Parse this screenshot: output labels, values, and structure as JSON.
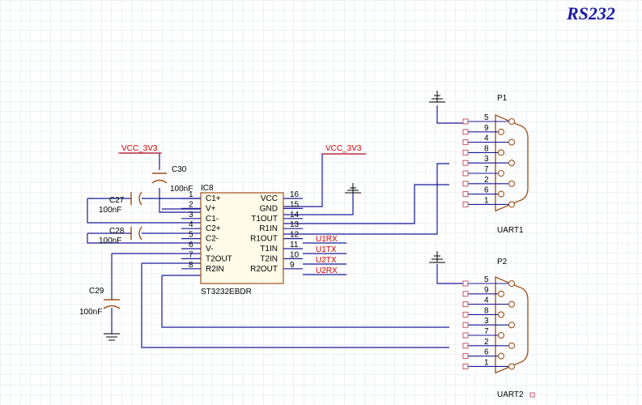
{
  "title": "RS232",
  "ic": {
    "ref": "IC8",
    "part": "ST3232EBDR",
    "left_pins": [
      {
        "num": "1",
        "name": "C1+"
      },
      {
        "num": "2",
        "name": "V+"
      },
      {
        "num": "3",
        "name": "C1-"
      },
      {
        "num": "4",
        "name": "C2+"
      },
      {
        "num": "5",
        "name": "C2-"
      },
      {
        "num": "6",
        "name": "V-"
      },
      {
        "num": "7",
        "name": "T2OUT"
      },
      {
        "num": "8",
        "name": "R2IN"
      }
    ],
    "right_pins": [
      {
        "num": "16",
        "name": "VCC"
      },
      {
        "num": "15",
        "name": "GND"
      },
      {
        "num": "14",
        "name": "T1OUT"
      },
      {
        "num": "13",
        "name": "R1IN"
      },
      {
        "num": "12",
        "name": "R1OUT"
      },
      {
        "num": "11",
        "name": "T1IN"
      },
      {
        "num": "10",
        "name": "T2IN"
      },
      {
        "num": "9",
        "name": "R2OUT"
      }
    ]
  },
  "capacitors": {
    "c30": {
      "ref": "C30",
      "value": "100nF"
    },
    "c27": {
      "ref": "C27",
      "value": "100nF"
    },
    "c28": {
      "ref": "C28",
      "value": "100nF"
    },
    "c29": {
      "ref": "C29",
      "value": "100nF"
    }
  },
  "power": {
    "vcc_left": "VCC_3V3",
    "vcc_right": "VCC_3V3"
  },
  "net_labels": {
    "r1out": "U1RX",
    "t1in": "U1TX",
    "t2in": "U2TX",
    "r2out": "U2RX"
  },
  "connectors": {
    "p1": {
      "ref": "P1",
      "name": "UART1",
      "pins": [
        "5",
        "9",
        "4",
        "8",
        "3",
        "7",
        "2",
        "6",
        "1"
      ]
    },
    "p2": {
      "ref": "P2",
      "name": "UART2",
      "pins": [
        "5",
        "9",
        "4",
        "8",
        "3",
        "7",
        "2",
        "6",
        "1"
      ]
    }
  },
  "colors": {
    "wire": "#1a1a99",
    "component": "#a0521a",
    "net_label": "#d00000",
    "grid": "#d8e4f0",
    "connector_pad": "#cc5566",
    "title": "#1a1aa6"
  }
}
